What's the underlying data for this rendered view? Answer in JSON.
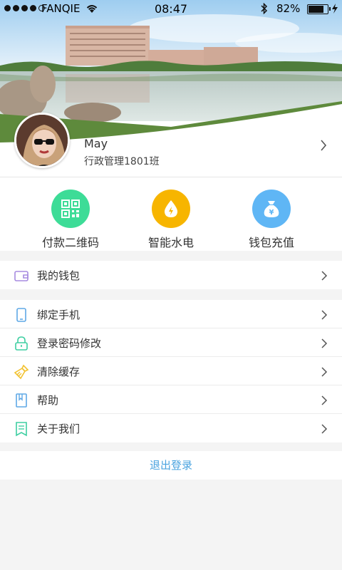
{
  "status_bar": {
    "carrier": "FANQIE",
    "time": "08:47",
    "battery_percent": "82%",
    "battery_level": 0.82,
    "signal_bars": 4,
    "signal_max": 5,
    "icons": [
      "signal-dots-icon",
      "wifi-icon",
      "bluetooth-icon",
      "battery-icon",
      "charging-icon"
    ]
  },
  "profile": {
    "name": "May",
    "class_name": "行政管理1801班"
  },
  "quick_actions": [
    {
      "label": "付款二维码",
      "icon": "qr-code-icon",
      "color": "#3ddc97"
    },
    {
      "label": "智能水电",
      "icon": "water-electricity-icon",
      "color": "#f7b500"
    },
    {
      "label": "钱包充值",
      "icon": "money-bag-icon",
      "color": "#5fb6f5"
    }
  ],
  "wallet_group": [
    {
      "label": "我的钱包",
      "icon": "wallet-icon"
    }
  ],
  "settings_group": [
    {
      "label": "绑定手机",
      "icon": "phone-icon"
    },
    {
      "label": "登录密码修改",
      "icon": "lock-icon"
    },
    {
      "label": "清除缓存",
      "icon": "broom-icon"
    },
    {
      "label": "帮助",
      "icon": "book-icon"
    },
    {
      "label": "关于我们",
      "icon": "document-icon"
    }
  ],
  "logout_label": "退出登录",
  "colors": {
    "accent": "#4aa3df",
    "background": "#f4f4f4"
  }
}
